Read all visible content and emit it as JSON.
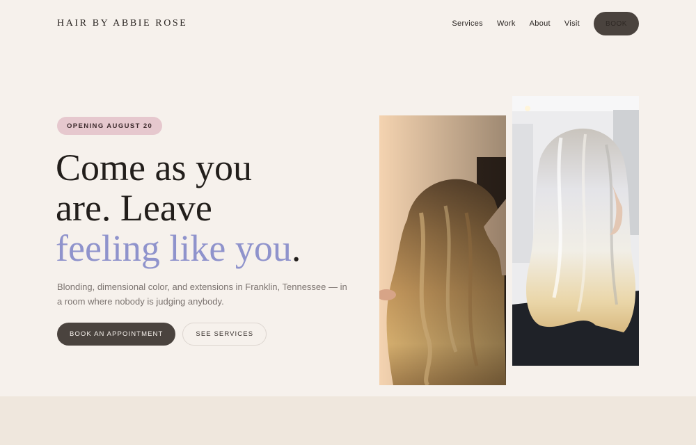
{
  "brand": "HAIR BY ABBIE ROSE",
  "nav": {
    "items": [
      "Services",
      "Work",
      "About",
      "Visit"
    ],
    "book": "BOOK"
  },
  "hero": {
    "badge": "OPENING AUGUST 20",
    "headline_line1": "Come as you",
    "headline_line2": "are. Leave",
    "headline_accent": "feeling like you",
    "headline_end": ".",
    "subtext": "Blonding, dimensional color, and extensions in Franklin, Tennessee — in a room where nobody is judging anybody.",
    "cta_primary": "BOOK AN APPOINTMENT",
    "cta_secondary": "SEE SERVICES"
  },
  "colors": {
    "background": "#f6f1ec",
    "accent": "#8f93cc",
    "dark_button": "#4a433e",
    "badge": "#e6c8ce",
    "band": "#efe7dd"
  }
}
